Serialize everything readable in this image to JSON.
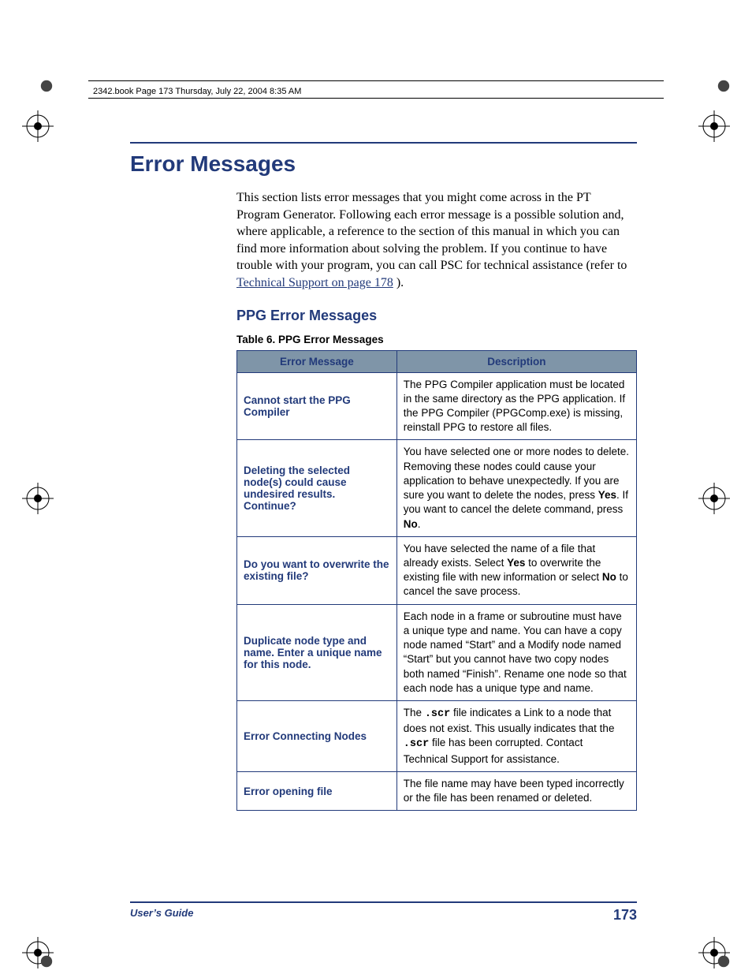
{
  "header_line": "2342.book  Page 173  Thursday, July 22, 2004  8:35 AM",
  "title": "Error Messages",
  "intro": {
    "text_before_link": "This section lists error messages that you might come across in the PT Program Generator. Following each error message is a possible solution and, where applicable, a reference to the section of this manual in which you can find more information about solving the problem. If you continue to have trouble with your program, you can call PSC for technical assistance (refer to ",
    "link_text": "Technical Support on page 178",
    "text_after_link": ")."
  },
  "subheading": "PPG Error Messages",
  "table_caption": "Table 6. PPG Error Messages",
  "table": {
    "headers": {
      "col1": "Error Message",
      "col2": "Description"
    },
    "rows": [
      {
        "msg": "Cannot start the PPG Compiler",
        "desc": "The PPG Compiler application must be located in the same directory as the PPG application. If the PPG Compiler (PPGComp.exe) is missing, reinstall PPG to restore all files."
      },
      {
        "msg": "Deleting the selected node(s) could cause undesired results. Continue?",
        "desc_html": "You have selected one or more nodes to delete. Removing these nodes could cause your application to behave unexpectedly. If you are sure you want to delete the nodes, press <b>Yes</b>. If you want to cancel the delete command, press <b>No</b>."
      },
      {
        "msg": "Do you want to overwrite the existing file?",
        "desc_html": "You have selected the name of a file that already exists. Select <b>Yes</b> to overwrite the existing file with new information or select <b>No</b> to cancel the save process."
      },
      {
        "msg": "Duplicate node type and name. Enter a unique name for this node.",
        "desc": "Each node in a frame or subroutine must have a unique type and name. You can have a copy node named “Start” and a Modify node named “Start” but you cannot have two copy nodes both named “Finish”. Rename one node so that each node has a unique type and name."
      },
      {
        "msg": "Error Connecting Nodes",
        "desc_html": "The <span class='mono'>.scr</span> file indicates a Link to a node that does not exist. This usually indicates that the <span class='mono'>.scr</span> file has been corrupted. Contact Technical Support for assistance."
      },
      {
        "msg": "Error opening file",
        "desc": "The file name may have been typed incorrectly or the file has been renamed or deleted."
      }
    ]
  },
  "footer": {
    "left": "User’s Guide",
    "right": "173"
  }
}
